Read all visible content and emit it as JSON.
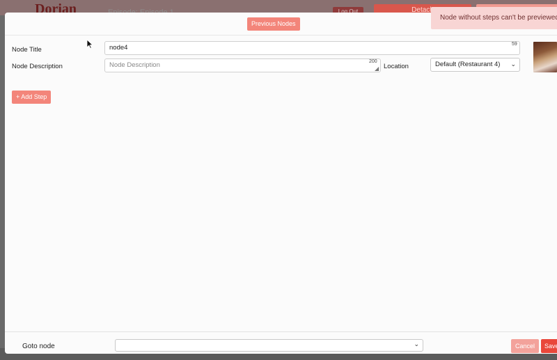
{
  "background": {
    "brand": "Dorian",
    "episode": "Episode: Episode 1",
    "logout": "Log Out",
    "tab_detach": "Detach"
  },
  "modal": {
    "previous_nodes_label": "Previous Nodes",
    "node_title": {
      "label": "Node Title",
      "value": "node4",
      "remaining_chars": "59"
    },
    "node_description": {
      "label": "Node Description",
      "placeholder": "Node Description",
      "remaining_chars": "200"
    },
    "location": {
      "label": "Location",
      "selected": "Default (Restaurant 4)"
    },
    "add_step_label": "+ Add Step",
    "footer": {
      "goto_label": "Goto node",
      "cancel_label": "Cancel",
      "save_label": "Save"
    }
  },
  "toast": {
    "message": "Node without steps can't be previewed"
  },
  "colors": {
    "accent": "#f3857a",
    "save": "#e9473a",
    "toast_bg": "#f8d5d4"
  }
}
